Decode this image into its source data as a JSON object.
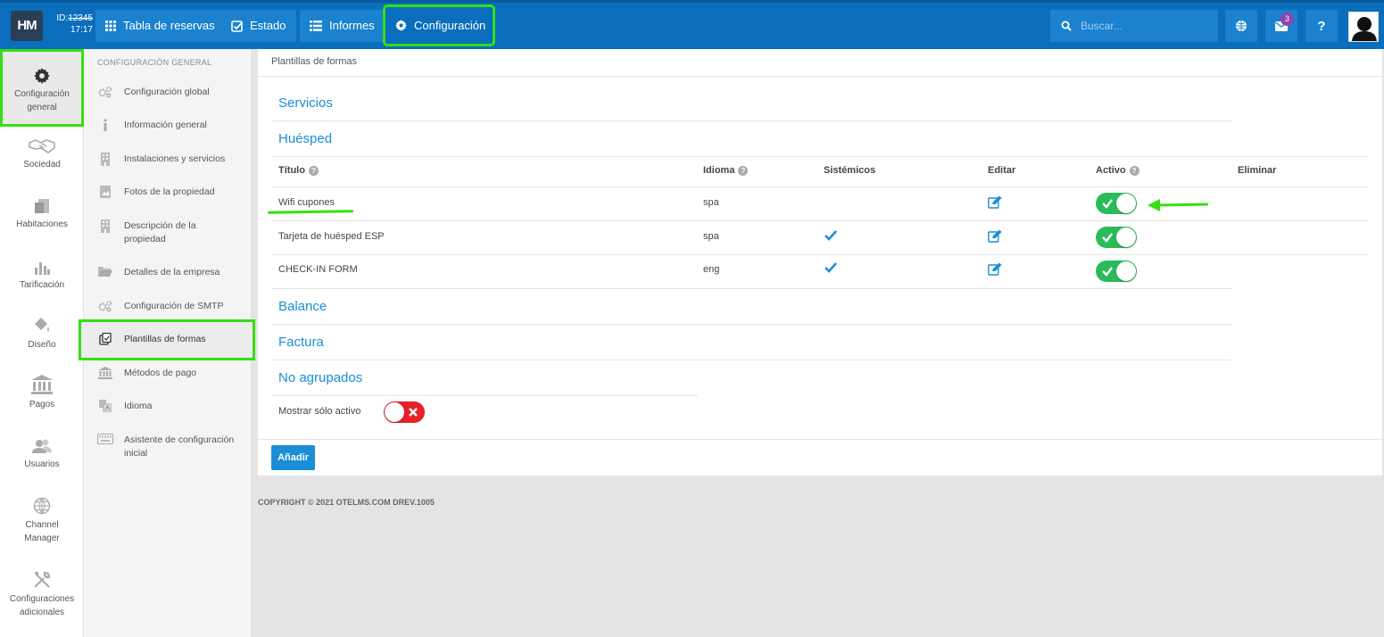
{
  "topbar": {
    "logo": "HM",
    "id_label": "ID:",
    "id_value": "12345",
    "time": "17:17",
    "nav": [
      {
        "label": "Tabla de reservas",
        "icon": "grid-icon"
      },
      {
        "label": "Estado",
        "icon": "checkbox-icon"
      },
      {
        "label": "Informes",
        "icon": "list-icon"
      },
      {
        "label": "Configuración",
        "icon": "gear-icon",
        "active": true
      }
    ],
    "search_placeholder": "Buscar...",
    "notifications_count": "3",
    "help_label": "?"
  },
  "sidebar": {
    "items": [
      {
        "label": "Configuración general",
        "icon": "gear-icon",
        "active": true
      },
      {
        "label": "Sociedad",
        "icon": "handshake-icon"
      },
      {
        "label": "Habitaciones",
        "icon": "rooms-icon"
      },
      {
        "label": "Tarificación",
        "icon": "bar-chart-icon"
      },
      {
        "label": "Diseño",
        "icon": "paint-bucket-icon"
      },
      {
        "label": "Pagos",
        "icon": "bank-icon"
      },
      {
        "label": "Usuarios",
        "icon": "users-icon"
      },
      {
        "label": "Channel Manager",
        "icon": "globe-icon"
      },
      {
        "label": "Configuraciones adicionales",
        "icon": "tools-icon"
      }
    ]
  },
  "subnav": {
    "heading": "CONFIGURACIÓN GENERAL",
    "items": [
      {
        "label": "Configuración global",
        "icon": "gears-icon"
      },
      {
        "label": "Información general",
        "icon": "info-icon"
      },
      {
        "label": "Instalaciones y servicios",
        "icon": "building-icon"
      },
      {
        "label": "Fotos de la propiedad",
        "icon": "photo-icon"
      },
      {
        "label": "Descripción de la propiedad",
        "icon": "building-icon"
      },
      {
        "label": "Detalles de la empresa",
        "icon": "folder-icon"
      },
      {
        "label": "Configuración de SMTP",
        "icon": "gears-icon"
      },
      {
        "label": "Plantillas de formas",
        "icon": "forms-icon",
        "active": true
      },
      {
        "label": "Métodos de pago",
        "icon": "bank-icon"
      },
      {
        "label": "Idioma",
        "icon": "language-icon"
      },
      {
        "label": "Asistente de configuración inicial",
        "icon": "keyboard-icon"
      }
    ]
  },
  "main": {
    "title": "Plantillas de formas",
    "groups": {
      "servicios": "Servicios",
      "huesped": "Huésped",
      "balance": "Balance",
      "factura": "Factura",
      "no_agrupados": "No agrupados"
    },
    "columns": {
      "titulo": "Título",
      "idioma": "Idioma",
      "sistemicos": "Sistémicos",
      "editar": "Editar",
      "activo": "Activo",
      "eliminar": "Eliminar"
    },
    "rows": [
      {
        "titulo": "Wifi cupones",
        "idioma": "spa",
        "sistemico": false,
        "activo": true
      },
      {
        "titulo": "Tarjeta de huésped ESP",
        "idioma": "spa",
        "sistemico": true,
        "activo": true
      },
      {
        "titulo": "CHECK-IN FORM",
        "idioma": "eng",
        "sistemico": true,
        "activo": true
      }
    ],
    "show_active_label": "Mostrar sólo activo",
    "show_active_value": false,
    "add_button": "Añadir"
  },
  "footer": "COPYRIGHT © 2021 OTELMS.COM DREV.1005",
  "colors": {
    "topbar": "#0a6ebd",
    "accent": "#1a8fd7",
    "toggle_on": "#2abb5a",
    "toggle_off": "#e8202a",
    "highlight": "#33e012"
  }
}
